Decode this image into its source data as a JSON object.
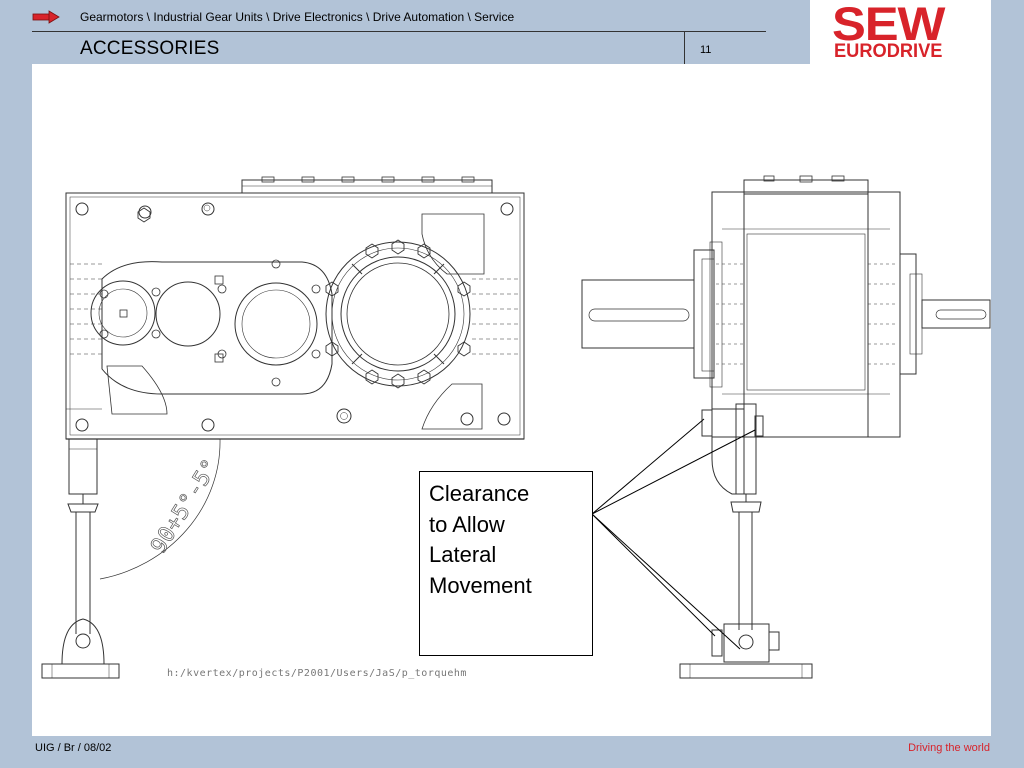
{
  "header": {
    "breadcrumb": "Gearmotors \\ Industrial Gear Units \\ Drive Electronics \\ Drive Automation \\ Service",
    "title": "ACCESSORIES",
    "page_number": "11",
    "arrow_icon": "right-arrow-icon"
  },
  "logo": {
    "line1": "SEW",
    "line2": "EURODRIVE",
    "color": "#d8232a"
  },
  "drawing": {
    "angle_label": "90+5°-5°",
    "file_path": "h:/kvertex/projects/P2001/Users/JaS/p_torquehm"
  },
  "callout": {
    "lines": [
      "Clearance",
      "to Allow",
      "Lateral",
      "Movement"
    ]
  },
  "footer": {
    "left": "UIG / Br / 08/02",
    "right": "Driving the world"
  },
  "colors": {
    "background": "#b2c3d7",
    "accent": "#d8232a"
  }
}
